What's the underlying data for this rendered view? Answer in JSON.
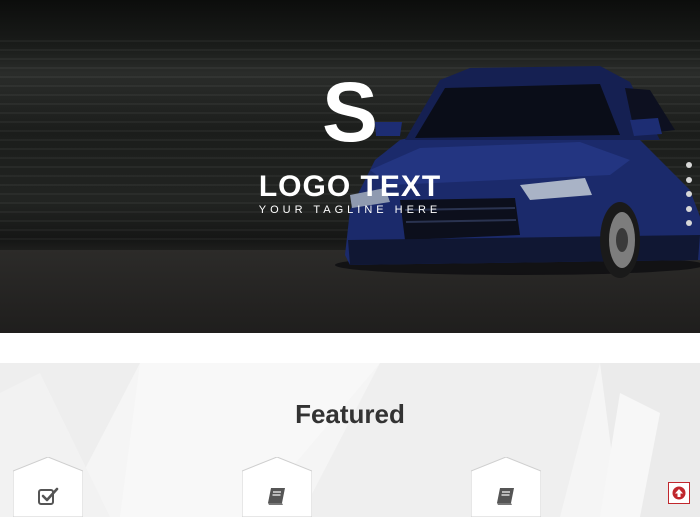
{
  "hero": {
    "logo_letter": "S",
    "logo_text": "LOGO TEXT",
    "tagline": "YOUR TAGLINE HERE",
    "slide_count": 5
  },
  "featured": {
    "title": "Featured",
    "cards": [
      {
        "icon": "check-square-icon"
      },
      {
        "icon": "book-icon"
      },
      {
        "icon": "book-icon"
      }
    ]
  },
  "colors": {
    "accent": "#c0272d",
    "icon": "#555555",
    "heading": "#333333"
  }
}
